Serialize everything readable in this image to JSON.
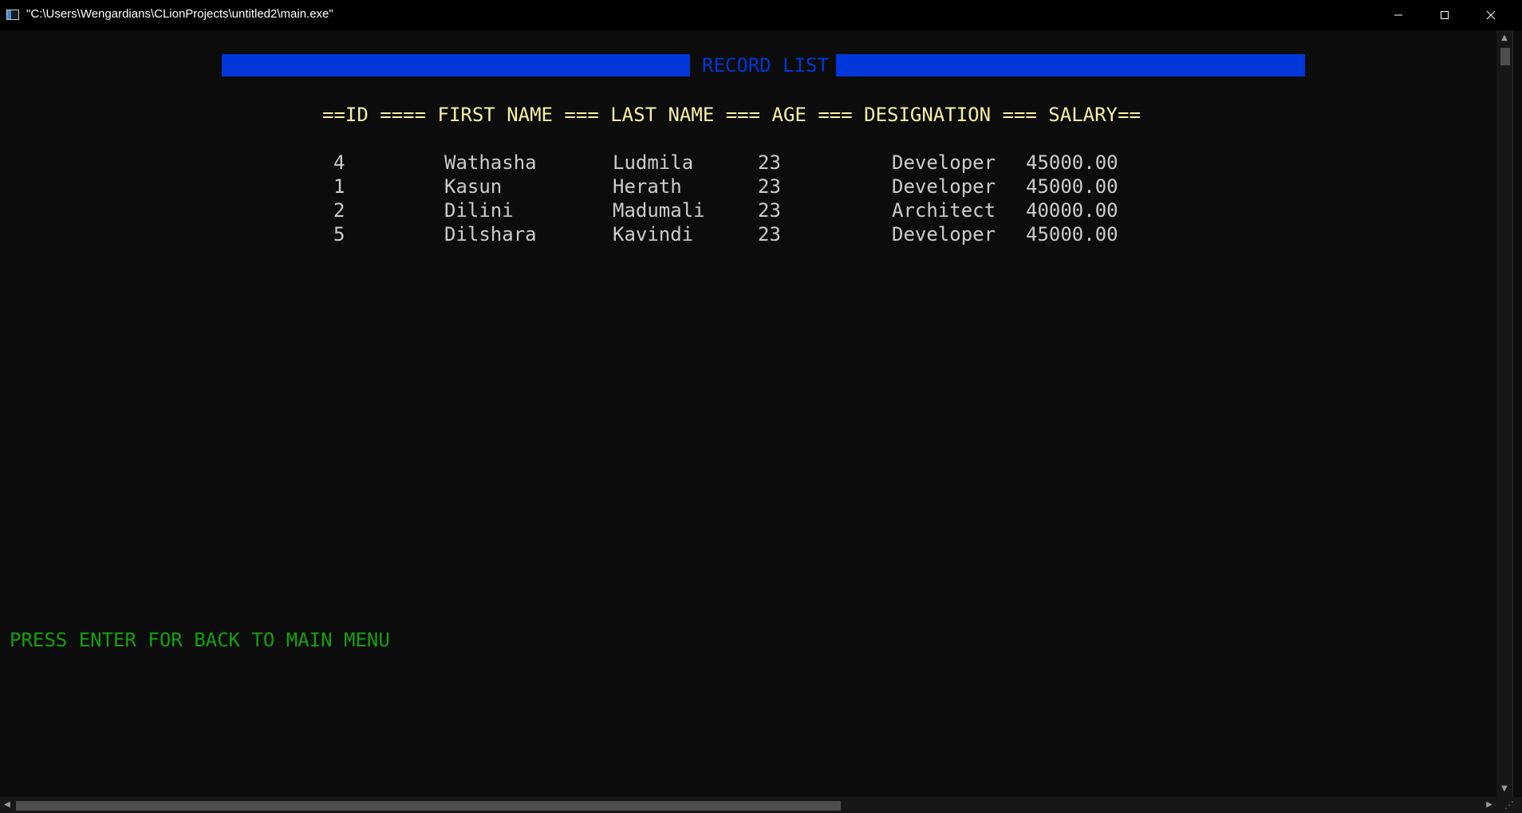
{
  "window": {
    "title": "\"C:\\Users\\Wengardians\\CLionProjects\\untitled2\\main.exe\""
  },
  "console": {
    "banner_title": "RECORD LIST",
    "header": "==ID ==== FIRST NAME === LAST NAME === AGE === DESIGNATION === SALARY==",
    "records": [
      {
        "id": "4",
        "first_name": "Wathasha",
        "last_name": "Ludmila",
        "age": "23",
        "designation": "Developer",
        "salary": "45000.00"
      },
      {
        "id": "1",
        "first_name": "Kasun",
        "last_name": "Herath",
        "age": "23",
        "designation": "Developer",
        "salary": "45000.00"
      },
      {
        "id": "2",
        "first_name": "Dilini",
        "last_name": "Madumali",
        "age": "23",
        "designation": "Architect",
        "salary": "40000.00"
      },
      {
        "id": "5",
        "first_name": "Dilshara",
        "last_name": "Kavindi",
        "age": "23",
        "designation": "Developer",
        "salary": "45000.00"
      }
    ],
    "prompt": "PRESS ENTER FOR BACK TO MAIN MENU"
  },
  "colors": {
    "background": "#0c0c0c",
    "banner_blue": "#0037da",
    "header_yellow": "#f9f1a5",
    "text_gray": "#cccccc",
    "prompt_green": "#13a10e"
  },
  "icons": {
    "app": "console-app-icon",
    "minimize": "minimize-icon",
    "maximize": "maximize-icon",
    "close": "close-icon"
  }
}
